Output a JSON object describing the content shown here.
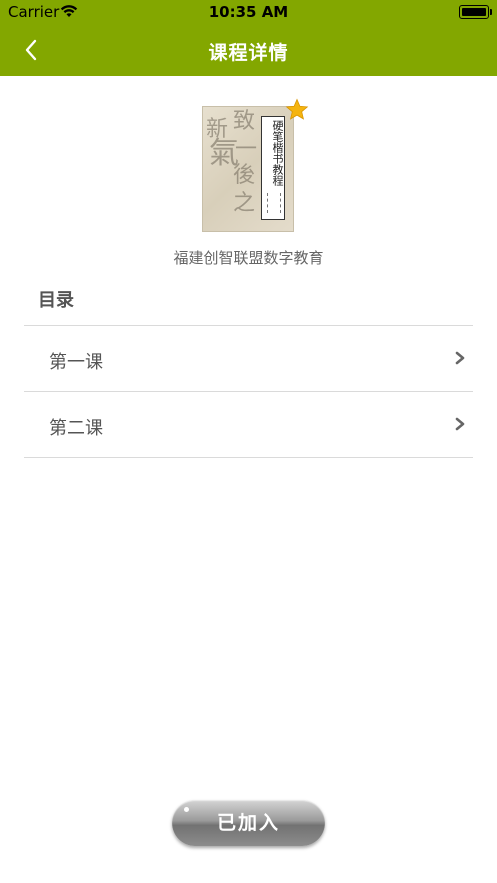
{
  "status_bar": {
    "carrier": "Carrier",
    "time": "10:35 AM"
  },
  "nav": {
    "title": "课程详情",
    "back_icon": "chevron-left-icon"
  },
  "course": {
    "cover_title": "硬笔楷书教程",
    "publisher": "福建创智联盟数字教育",
    "star_icon": "star-icon"
  },
  "catalog": {
    "heading": "目录",
    "items": [
      {
        "label": "第一课"
      },
      {
        "label": "第二课"
      }
    ]
  },
  "action": {
    "label": "已加入"
  },
  "colors": {
    "header": "#83a700",
    "text": "#555555"
  }
}
